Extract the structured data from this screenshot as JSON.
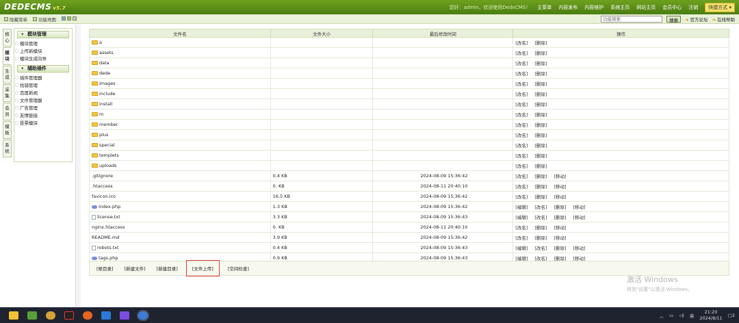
{
  "header": {
    "logo": "DEDECMS",
    "version": "v5.7",
    "welcome": "您好：admin，欢迎使用DedeCMS！",
    "nav": [
      "主菜单",
      "内容发布",
      "内容维护",
      "系统主页",
      "网站主页",
      "会员中心",
      "注销"
    ],
    "quick_menu": "快捷方式"
  },
  "subbar": {
    "hide_menu": "隐藏菜单",
    "func_map": "功能地图",
    "search_placeholder": "功能搜索",
    "search_button": "搜索",
    "forum": "官方论坛",
    "help": "在线帮助"
  },
  "vtabs": [
    "核心",
    "模块",
    "生成",
    "采集",
    "会员",
    "模板",
    "系统"
  ],
  "sidebar": {
    "group1": {
      "title": "模块管理",
      "items": [
        "模块管理",
        "上传新模块",
        "模块生成向导"
      ]
    },
    "group2": {
      "title": "辅助插件",
      "items": [
        "插件管理器",
        "找错管理",
        "百度新闻",
        "文件管理器",
        "广告管理",
        "友情链接",
        "投票模块"
      ]
    }
  },
  "table": {
    "headers": [
      "文件名",
      "文件大小",
      "最后修改时间",
      "操作"
    ],
    "rows": [
      {
        "name": "a",
        "type": "folder",
        "size": "",
        "time": "",
        "ops": [
          "[改名]",
          "[删除]"
        ]
      },
      {
        "name": "assets",
        "type": "folder",
        "size": "",
        "time": "",
        "ops": [
          "[改名]",
          "[删除]"
        ]
      },
      {
        "name": "data",
        "type": "folder",
        "size": "",
        "time": "",
        "ops": [
          "[改名]",
          "[删除]"
        ]
      },
      {
        "name": "dede",
        "type": "folder",
        "size": "",
        "time": "",
        "ops": [
          "[改名]",
          "[删除]"
        ]
      },
      {
        "name": "images",
        "type": "folder",
        "size": "",
        "time": "",
        "ops": [
          "[改名]",
          "[删除]"
        ]
      },
      {
        "name": "include",
        "type": "folder",
        "size": "",
        "time": "",
        "ops": [
          "[改名]",
          "[删除]"
        ]
      },
      {
        "name": "install",
        "type": "folder",
        "size": "",
        "time": "",
        "ops": [
          "[改名]",
          "[删除]"
        ]
      },
      {
        "name": "m",
        "type": "folder",
        "size": "",
        "time": "",
        "ops": [
          "[改名]",
          "[删除]"
        ]
      },
      {
        "name": "member",
        "type": "folder",
        "size": "",
        "time": "",
        "ops": [
          "[改名]",
          "[删除]"
        ]
      },
      {
        "name": "plus",
        "type": "folder",
        "size": "",
        "time": "",
        "ops": [
          "[改名]",
          "[删除]"
        ]
      },
      {
        "name": "special",
        "type": "folder",
        "size": "",
        "time": "",
        "ops": [
          "[改名]",
          "[删除]"
        ]
      },
      {
        "name": "templets",
        "type": "folder",
        "size": "",
        "time": "",
        "ops": [
          "[改名]",
          "[删除]"
        ]
      },
      {
        "name": "uploads",
        "type": "folder",
        "size": "",
        "time": "",
        "ops": [
          "[改名]",
          "[删除]"
        ]
      },
      {
        "name": ".gitignore",
        "type": "none",
        "size": "0.4 KB",
        "time": "2024-08-09 15:36:42",
        "ops": [
          "[改名]",
          "[删除]",
          "[移动]"
        ]
      },
      {
        "name": ".htaccess",
        "type": "none",
        "size": "0. KB",
        "time": "2024-08-11 20:40:10",
        "ops": [
          "[改名]",
          "[删除]",
          "[移动]"
        ]
      },
      {
        "name": "favicon.ico",
        "type": "none",
        "size": "16.5 KB",
        "time": "2024-08-09 15:36:42",
        "ops": [
          "[改名]",
          "[删除]",
          "[移动]"
        ]
      },
      {
        "name": "index.php",
        "type": "php",
        "size": "1.3 KB",
        "time": "2024-08-09 15:36:42",
        "ops": [
          "[编辑]",
          "[改名]",
          "[删除]",
          "[移动]"
        ]
      },
      {
        "name": "license.txt",
        "type": "file",
        "size": "3.3 KB",
        "time": "2024-08-09 15:36:43",
        "ops": [
          "[编辑]",
          "[改名]",
          "[删除]",
          "[移动]"
        ]
      },
      {
        "name": "nginx.htaccess",
        "type": "none",
        "size": "0. KB",
        "time": "2024-08-11 20:40:10",
        "ops": [
          "[改名]",
          "[删除]",
          "[移动]"
        ]
      },
      {
        "name": "README.md",
        "type": "none",
        "size": "3.9 KB",
        "time": "2024-08-09 15:36:42",
        "ops": [
          "[改名]",
          "[删除]",
          "[移动]"
        ]
      },
      {
        "name": "robots.txt",
        "type": "file",
        "size": "0.4 KB",
        "time": "2024-08-09 15:36:43",
        "ops": [
          "[编辑]",
          "[改名]",
          "[删除]",
          "[移动]"
        ]
      },
      {
        "name": "tags.php",
        "type": "php",
        "size": "0.9 KB",
        "time": "2024-08-09 15:36:43",
        "ops": [
          "[编辑]",
          "[改名]",
          "[删除]",
          "[移动]"
        ]
      }
    ]
  },
  "bottom_actions": [
    "[根目录]",
    "[新建文件]",
    "[新建目录]",
    "[文件上传]",
    "[空间检查]"
  ],
  "watermark": {
    "line1": "激活 Windows",
    "line2": "转到\"设置\"以激活 Windows。"
  },
  "tray": {
    "lang": "英",
    "time": "21:20",
    "date": "2024/8/11",
    "notif": "2"
  }
}
